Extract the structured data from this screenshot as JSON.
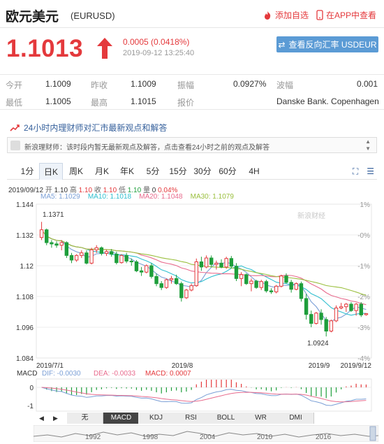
{
  "header": {
    "name": "欧元美元",
    "code": "(EURUSD)",
    "add_watch": "添加自选",
    "app_view": "在APP中查看"
  },
  "quote": {
    "price": "1.1013",
    "change": "0.0005 (0.0418%)",
    "time": "2019-09-12 13:25:40",
    "reverse_button": "查看反向汇率 USDEUR"
  },
  "stats": {
    "open_label": "今开",
    "open": "1.1009",
    "prev_label": "昨收",
    "prev": "1.1009",
    "amp_label": "振幅",
    "amp": "0.0927%",
    "wave_label": "波幅",
    "wave": "0.001",
    "low_label": "最低",
    "low": "1.1005",
    "high_label": "最高",
    "high": "1.1015",
    "quote_label": "报价",
    "quote_src": "Danske Bank. Copenhagen"
  },
  "notice": {
    "title": "24小时内理财师对汇市最新观点和解答",
    "text": "新浪理财师：该时段内暂无最新观点及解答，点击查看24小时之前的观点及解答"
  },
  "tabs": [
    "1分",
    "日K",
    "周K",
    "月K",
    "年K",
    "5分",
    "15分",
    "30分",
    "60分",
    "4H"
  ],
  "active_tab": "日K",
  "chart_info": {
    "date": "2019/09/12",
    "open_label": "开",
    "open": "1.10",
    "high_label": "高",
    "high": "1.10",
    "close_label": "收",
    "close": "1.10",
    "low_label": "低",
    "low": "1.10",
    "vol_label": "量",
    "vol": "0",
    "pct": "0.04%",
    "ma5": "MA5: 1.1029",
    "ma10": "MA10: 1.1018",
    "ma20": "MA20: 1.1048",
    "ma30": "MA30: 1.1079",
    "watermark": "新浪财经",
    "macd_label": "MACD",
    "dif": "DIF: -0.0030",
    "dea": "DEA: -0.0033",
    "macd": "MACD: 0.0007"
  },
  "colors": {
    "up": "#e4393c",
    "down": "#1e9e3b",
    "ma5": "#7a9fd6",
    "ma10": "#2fbfcf",
    "ma20": "#e86b8d",
    "ma30": "#9abf3d",
    "link": "#345f9b"
  },
  "chart_data": {
    "type": "candlestick",
    "y_ticks": [
      "1.144",
      "1.132",
      "1.12",
      "1.108",
      "1.096",
      "1.084"
    ],
    "right_ticks": [
      "1%",
      "-0%",
      "-1%",
      "-2%",
      "-3%",
      "-4%"
    ],
    "x_ticks": [
      "2019/7/1",
      "2019/8",
      "2019/9",
      "2019/9/12"
    ],
    "ylim": [
      1.084,
      1.144
    ],
    "annotations": [
      "1.1371",
      "1.0924"
    ],
    "macd_ticks": [
      "0",
      "-1"
    ],
    "candles": [
      [
        1.131,
        1.1371,
        1.13,
        1.134
      ],
      [
        1.134,
        1.1345,
        1.128,
        1.129
      ],
      [
        1.129,
        1.13,
        1.127,
        1.1285
      ],
      [
        1.1285,
        1.1295,
        1.127,
        1.128
      ],
      [
        1.128,
        1.13,
        1.126,
        1.129
      ],
      [
        1.129,
        1.1295,
        1.123,
        1.124
      ],
      [
        1.124,
        1.125,
        1.121,
        1.1222
      ],
      [
        1.1222,
        1.1245,
        1.1215,
        1.124
      ],
      [
        1.124,
        1.126,
        1.123,
        1.125
      ],
      [
        1.125,
        1.126,
        1.1205,
        1.121
      ],
      [
        1.121,
        1.127,
        1.1205,
        1.1262
      ],
      [
        1.1262,
        1.128,
        1.125,
        1.127
      ],
      [
        1.127,
        1.1275,
        1.124,
        1.1248
      ],
      [
        1.1248,
        1.1262,
        1.1238,
        1.1255
      ],
      [
        1.1255,
        1.1265,
        1.1235,
        1.1245
      ],
      [
        1.1245,
        1.1255,
        1.1205,
        1.1212
      ],
      [
        1.1212,
        1.1245,
        1.1208,
        1.124
      ],
      [
        1.124,
        1.125,
        1.121,
        1.1218
      ],
      [
        1.1218,
        1.1228,
        1.12,
        1.1215
      ],
      [
        1.1215,
        1.1222,
        1.1175,
        1.118
      ],
      [
        1.118,
        1.1195,
        1.116,
        1.1175
      ],
      [
        1.1175,
        1.1205,
        1.117,
        1.12
      ],
      [
        1.12,
        1.121,
        1.115,
        1.1158
      ],
      [
        1.1158,
        1.117,
        1.112,
        1.113
      ],
      [
        1.113,
        1.114,
        1.1105,
        1.1115
      ],
      [
        1.1115,
        1.115,
        1.111,
        1.1145
      ],
      [
        1.1145,
        1.116,
        1.113,
        1.115
      ],
      [
        1.115,
        1.1165,
        1.1125,
        1.113
      ],
      [
        1.113,
        1.1138,
        1.106,
        1.1075
      ],
      [
        1.1075,
        1.111,
        1.107,
        1.1105
      ],
      [
        1.1105,
        1.113,
        1.11,
        1.1122
      ],
      [
        1.1122,
        1.1228,
        1.1118,
        1.1215
      ],
      [
        1.1215,
        1.1235,
        1.118,
        1.1195
      ],
      [
        1.1195,
        1.124,
        1.119,
        1.123
      ],
      [
        1.123,
        1.124,
        1.1195,
        1.1205
      ],
      [
        1.1205,
        1.122,
        1.1185,
        1.121
      ],
      [
        1.121,
        1.1225,
        1.119,
        1.1195
      ],
      [
        1.1195,
        1.1235,
        1.1188,
        1.1228
      ],
      [
        1.1228,
        1.1238,
        1.119,
        1.1198
      ],
      [
        1.1198,
        1.121,
        1.114,
        1.115
      ],
      [
        1.115,
        1.1175,
        1.112,
        1.1165
      ],
      [
        1.1165,
        1.117,
        1.1125,
        1.113
      ],
      [
        1.113,
        1.115,
        1.11,
        1.114
      ],
      [
        1.114,
        1.1145,
        1.111,
        1.1115
      ],
      [
        1.1115,
        1.1145,
        1.1105,
        1.1138
      ],
      [
        1.1138,
        1.1145,
        1.1095,
        1.1102
      ],
      [
        1.1102,
        1.1112,
        1.109,
        1.1098
      ],
      [
        1.1098,
        1.1125,
        1.1092,
        1.112
      ],
      [
        1.112,
        1.1165,
        1.1115,
        1.116
      ],
      [
        1.116,
        1.117,
        1.113,
        1.1135
      ],
      [
        1.1135,
        1.1145,
        1.1095,
        1.1108
      ],
      [
        1.1108,
        1.1135,
        1.1104,
        1.113
      ],
      [
        1.113,
        1.1138,
        1.106,
        1.1072
      ],
      [
        1.1072,
        1.109,
        1.099,
        1.101
      ],
      [
        1.101,
        1.1025,
        1.096,
        1.0975
      ],
      [
        1.0975,
        1.102,
        1.097,
        1.1015
      ],
      [
        1.1015,
        1.103,
        1.097,
        1.099
      ],
      [
        1.099,
        1.1,
        1.0924,
        1.0945
      ],
      [
        1.0945,
        1.099,
        1.094,
        1.0985
      ],
      [
        1.0985,
        1.1045,
        1.098,
        1.1035
      ],
      [
        1.1035,
        1.1055,
        1.103,
        1.104
      ],
      [
        1.104,
        1.1055,
        1.102,
        1.105
      ],
      [
        1.105,
        1.1058,
        1.102,
        1.1025
      ],
      [
        1.1025,
        1.1055,
        1.1005,
        1.105
      ],
      [
        1.105,
        1.1058,
        1.1,
        1.1008
      ],
      [
        1.1009,
        1.1015,
        1.1005,
        1.1013
      ]
    ]
  },
  "indicator_tabs": [
    "无",
    "MACD",
    "KDJ",
    "RSI",
    "BOLL",
    "WR",
    "DMI"
  ],
  "active_indicator": "MACD",
  "timeline_years": [
    "1992",
    "1998",
    "2004",
    "2010",
    "2016"
  ]
}
